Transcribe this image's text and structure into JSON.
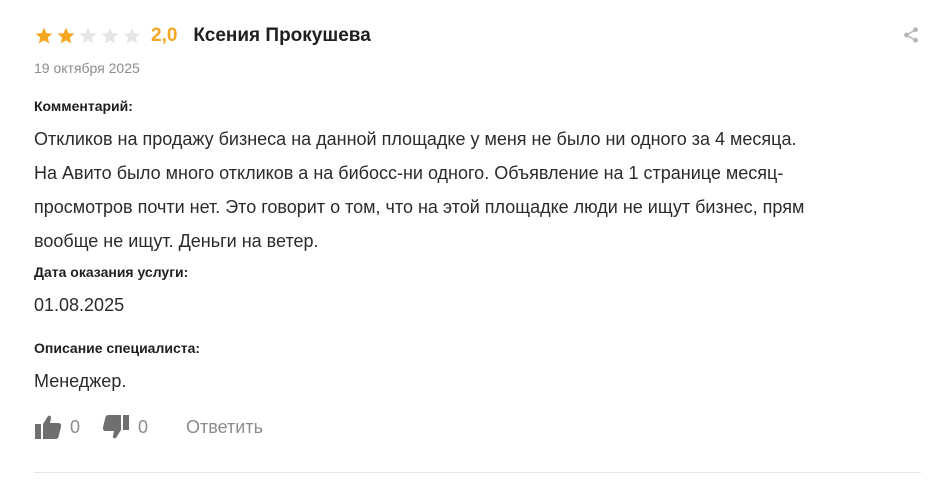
{
  "review": {
    "rating": "2,0",
    "rating_value": 2,
    "rating_max": 5,
    "author": "Ксения Прокушева",
    "date": "19 октября 2025",
    "comment_label": "Комментарий:",
    "comment_lines": [
      "Откликов на продажу бизнеса на данной площадке у меня не было ни одного за 4 месяца.",
      "На Авито было много откликов а на бибосс-ни одного. Объявление на 1 странице месяц-",
      "просмотров почти нет. Это говорит о том, что на этой площадке люди не ищут бизнес, прям",
      "вообще не ищут. Деньги на ветер."
    ],
    "service_date_label": "Дата оказания услуги:",
    "service_date": "01.08.2025",
    "specialist_label": "Описание специалиста:",
    "specialist": "Менеджер."
  },
  "actions": {
    "likes": "0",
    "dislikes": "0",
    "reply_label": "Ответить"
  },
  "colors": {
    "star_filled": "#f5a623",
    "star_empty": "#e6e6e6",
    "rating_text": "#f5a623",
    "muted": "#8c8c8c",
    "icon": "#6f6f6f",
    "share_icon": "#b5b5b5",
    "divider": "#e6e6e6"
  },
  "icons": {
    "stars": "star-icon",
    "share": "share-icon",
    "like": "thumbs-up-icon",
    "dislike": "thumbs-down-icon"
  }
}
